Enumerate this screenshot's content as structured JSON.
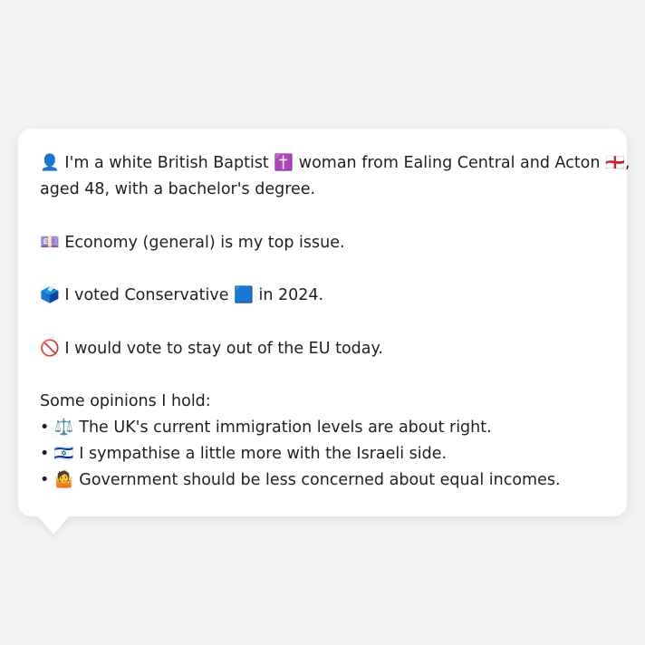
{
  "bio": {
    "line1_icon": "👤",
    "line1_text_a": "I'm a white British Baptist",
    "line1_icon2": "✝️",
    "line1_text_b": "woman from Ealing Central and Acton",
    "line1_icon3": "🏴󠁧󠁢󠁥󠁮󠁧󠁿",
    "line1_text_c": ",",
    "line2_text": "aged 48, with a bachelor's degree."
  },
  "issue": {
    "icon": "💷",
    "text": "Economy (general) is my top issue."
  },
  "vote": {
    "icon": "🗳️",
    "text_a": "I voted Conservative",
    "party_icon": "🟦",
    "text_b": "in 2024."
  },
  "eu": {
    "icon": "🚫",
    "text": "I would vote to stay out of the EU today."
  },
  "opinions": {
    "heading": "Some opinions I hold:",
    "items": [
      {
        "bullet": "•",
        "icon": "⚖️",
        "text": "The UK's current immigration levels are about right."
      },
      {
        "bullet": "•",
        "icon": "🇮🇱",
        "text": "I sympathise a little more with the Israeli side."
      },
      {
        "bullet": "•",
        "icon": "🤷",
        "text": "Government should be less concerned about equal incomes."
      }
    ]
  }
}
